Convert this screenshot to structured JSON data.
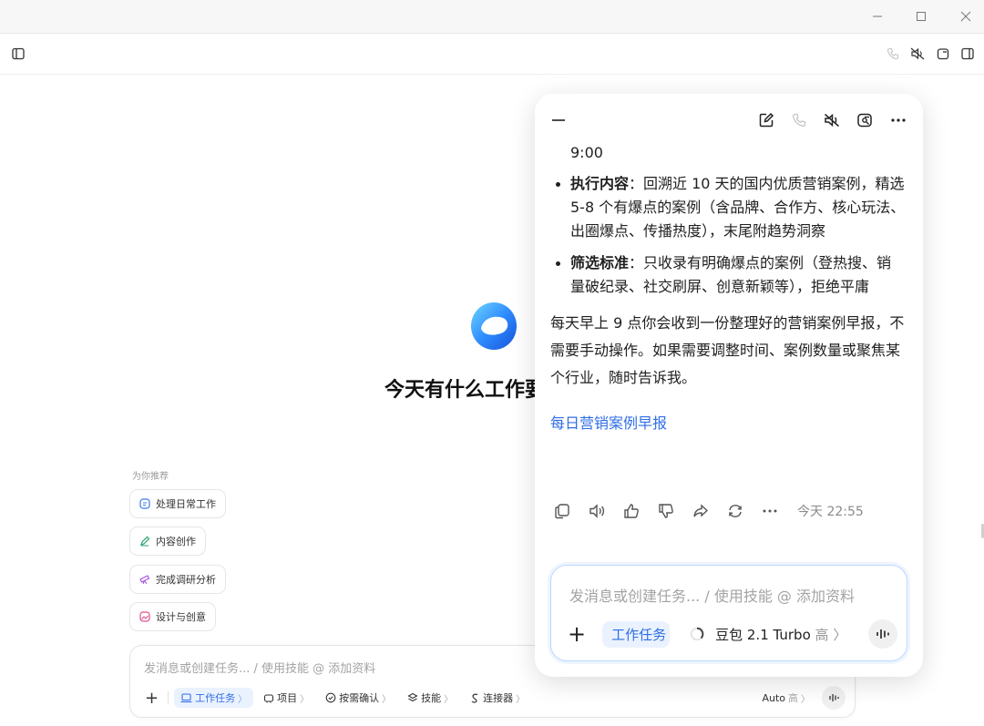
{
  "window": {
    "controls": [
      "minimize-icon",
      "maximize-icon",
      "close-icon"
    ]
  },
  "toolbar": {
    "left_icon": "sidebar-toggle-icon",
    "right_icons": [
      "phone-icon",
      "speaker-mute-icon",
      "new-window-icon",
      "sidebar-right-icon"
    ]
  },
  "main": {
    "hero_title": "今天有什么工作要",
    "recommend_label": "为你推荐",
    "chips": [
      {
        "label": "处理日常工作",
        "icon": "chat-icon",
        "color": "#3b7be8"
      },
      {
        "label": "内容创作",
        "icon": "pen-icon",
        "color": "#2aa36b"
      },
      {
        "label": "完成调研分析",
        "icon": "telescope-icon",
        "color": "#a34de0"
      },
      {
        "label": "设计与创意",
        "icon": "image-icon",
        "color": "#e04d8a"
      }
    ],
    "composer": {
      "placeholder": "发消息或创建任务... / 使用技能 @ 添加资料",
      "add_label": "+",
      "pills": [
        {
          "label": "工作任务",
          "chev": "〉",
          "icon": "laptop-icon"
        },
        {
          "label": "项目",
          "chev": "〉",
          "icon": "project-icon"
        },
        {
          "label": "按需确认",
          "chev": "〉",
          "icon": "check-circle-icon"
        },
        {
          "label": "技能",
          "chev": "〉",
          "icon": "layers-icon"
        },
        {
          "label": "连接器",
          "chev": "〉",
          "icon": "connector-icon"
        }
      ],
      "model_label": "Auto",
      "model_level": "高",
      "model_chev": "〉"
    }
  },
  "panel": {
    "top_icons": [
      "minimize-icon",
      "edit-icon",
      "phone-icon",
      "speaker-mute-icon",
      "screen-share-icon",
      "more-icon"
    ],
    "time_line": "9:00",
    "bullets": [
      {
        "title": "执行内容",
        "text": "：回溯近 10 天的国内优质营销案例，精选 5-8 个有爆点的案例（含品牌、合作方、核心玩法、出圈爆点、传播热度），末尾附趋势洞察"
      },
      {
        "title": "筛选标准",
        "text": "：只收录有明确爆点的案例（登热搜、销量破纪录、社交刷屏、创意新颖等），拒绝平庸"
      }
    ],
    "paragraph": "每天早上 9 点你会收到一份整理好的营销案例早报，不需要手动操作。如果需要调整时间、案例数量或聚焦某个行业，随时告诉我。",
    "link_text": "每日营销案例早报",
    "action_icons": [
      "copy-icon",
      "read-aloud-icon",
      "thumbs-up-icon",
      "thumbs-down-icon",
      "share-icon",
      "regenerate-icon",
      "more-icon"
    ],
    "timestamp": "今天 22:55",
    "input": {
      "placeholder": "发消息或创建任务... / 使用技能 @ 添加资料",
      "add_label": "+",
      "task_pill": "工作任务",
      "model_name": "豆包 2.1 Turbo",
      "model_level": "高",
      "model_chev": "〉"
    }
  }
}
